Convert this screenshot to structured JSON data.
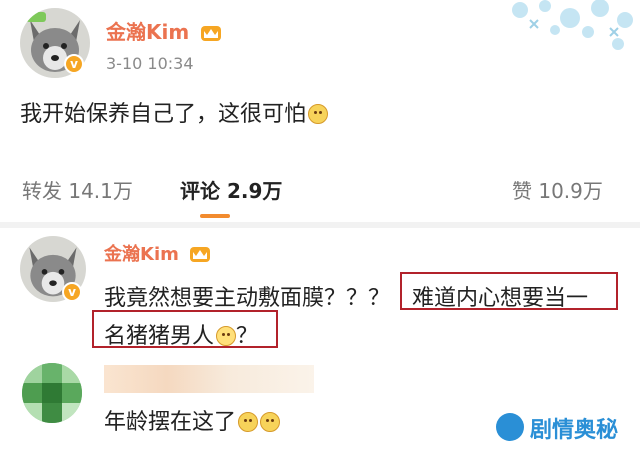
{
  "colors": {
    "accent": "#eb7350",
    "tab_underline": "#f28b2e",
    "highlight_box": "#b2222b",
    "watermark": "#2a8fd6"
  },
  "post": {
    "author": "金瀚Kim",
    "time": "3-10 10:34",
    "text": "我开始保养自己了，这很可怕",
    "emoji_icon": "smile-dog-emoji"
  },
  "actions": {
    "repost": "转发 14.1万",
    "comment": "评论 2.9万",
    "like": "赞 10.9万"
  },
  "comments": [
    {
      "author": "金瀚Kim",
      "text_line1": "我竟然想要主动敷面膜？？？",
      "text_highlight1": "难道内心想要当一",
      "text_highlight2": "名猪猪男人",
      "text_highlight2_tail": "？"
    },
    {
      "author": "",
      "text": "年龄摆在这了"
    }
  ],
  "watermark": "剧情奥秘"
}
